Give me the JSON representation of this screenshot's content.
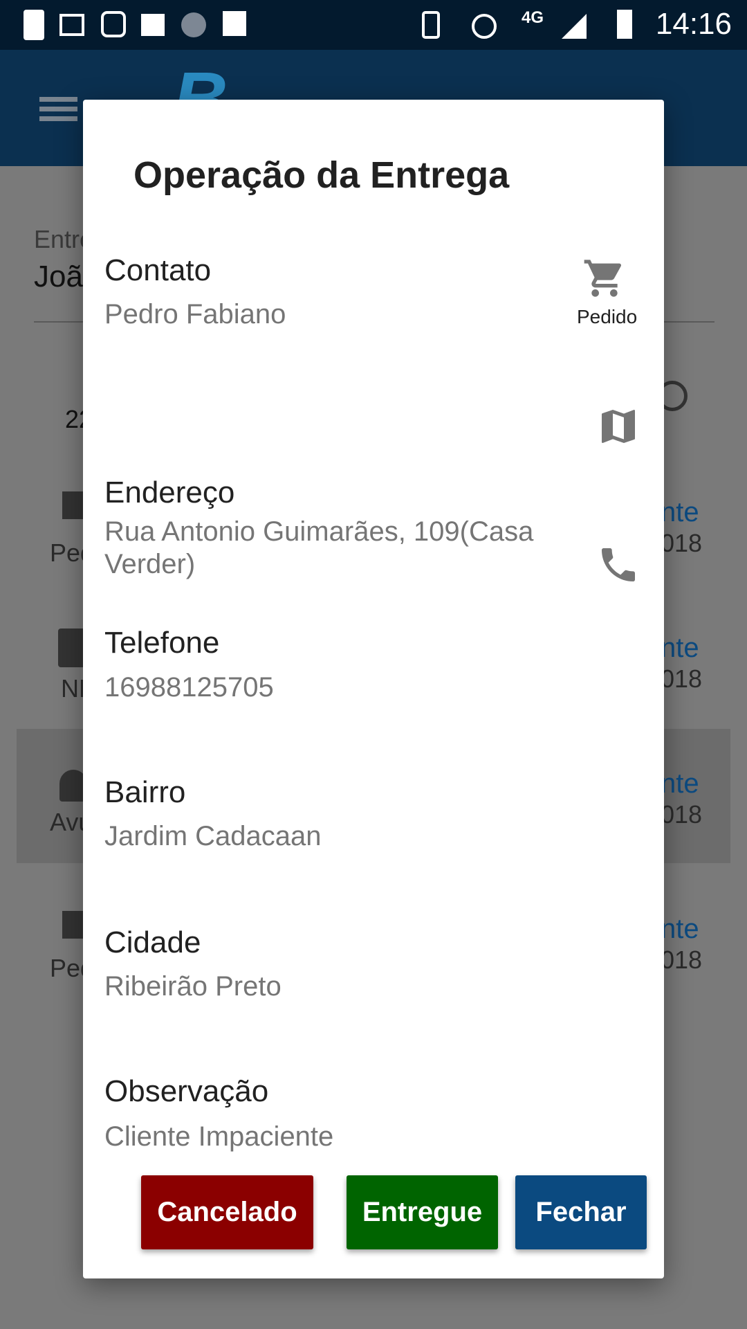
{
  "status_bar": {
    "time": "14:16",
    "network": "4G"
  },
  "background": {
    "header_label_partial": "Entre",
    "header_value_partial": "Joã",
    "date_partial": "22",
    "rows": [
      {
        "type_partial": "Ped",
        "status_partial": "nte",
        "date_partial": "018"
      },
      {
        "type_partial": "NF",
        "status_partial": "nte",
        "date_partial": "018"
      },
      {
        "type_partial": "Avu",
        "status_partial": "nte",
        "date_partial": "018"
      },
      {
        "type_partial": "Ped",
        "status_partial": "nte",
        "date_partial": "018"
      }
    ]
  },
  "dialog": {
    "title": "Operação da Entrega",
    "fields": [
      {
        "label": "Contato",
        "value": "Pedro Fabiano",
        "action_icon": "cart-icon",
        "action_label": "Pedido"
      },
      {
        "label": "Endereço",
        "value": "Rua Antonio Guimarães, 109(Casa Verder)",
        "action_icon": "map-icon"
      },
      {
        "label": "Telefone",
        "value": "16988125705",
        "action_icon": "phone-icon"
      },
      {
        "label": "Bairro",
        "value": "Jardim Cadacaan"
      },
      {
        "label": "Cidade",
        "value": "Ribeirão Preto"
      },
      {
        "label": "Observação",
        "value": "Cliente Impaciente"
      }
    ],
    "buttons": {
      "cancel": "Cancelado",
      "delivered": "Entregue",
      "close": "Fechar"
    }
  },
  "colors": {
    "cancel": "#8b0000",
    "delivered": "#006400",
    "close": "#0b4a80",
    "appbar": "#0b3050"
  }
}
